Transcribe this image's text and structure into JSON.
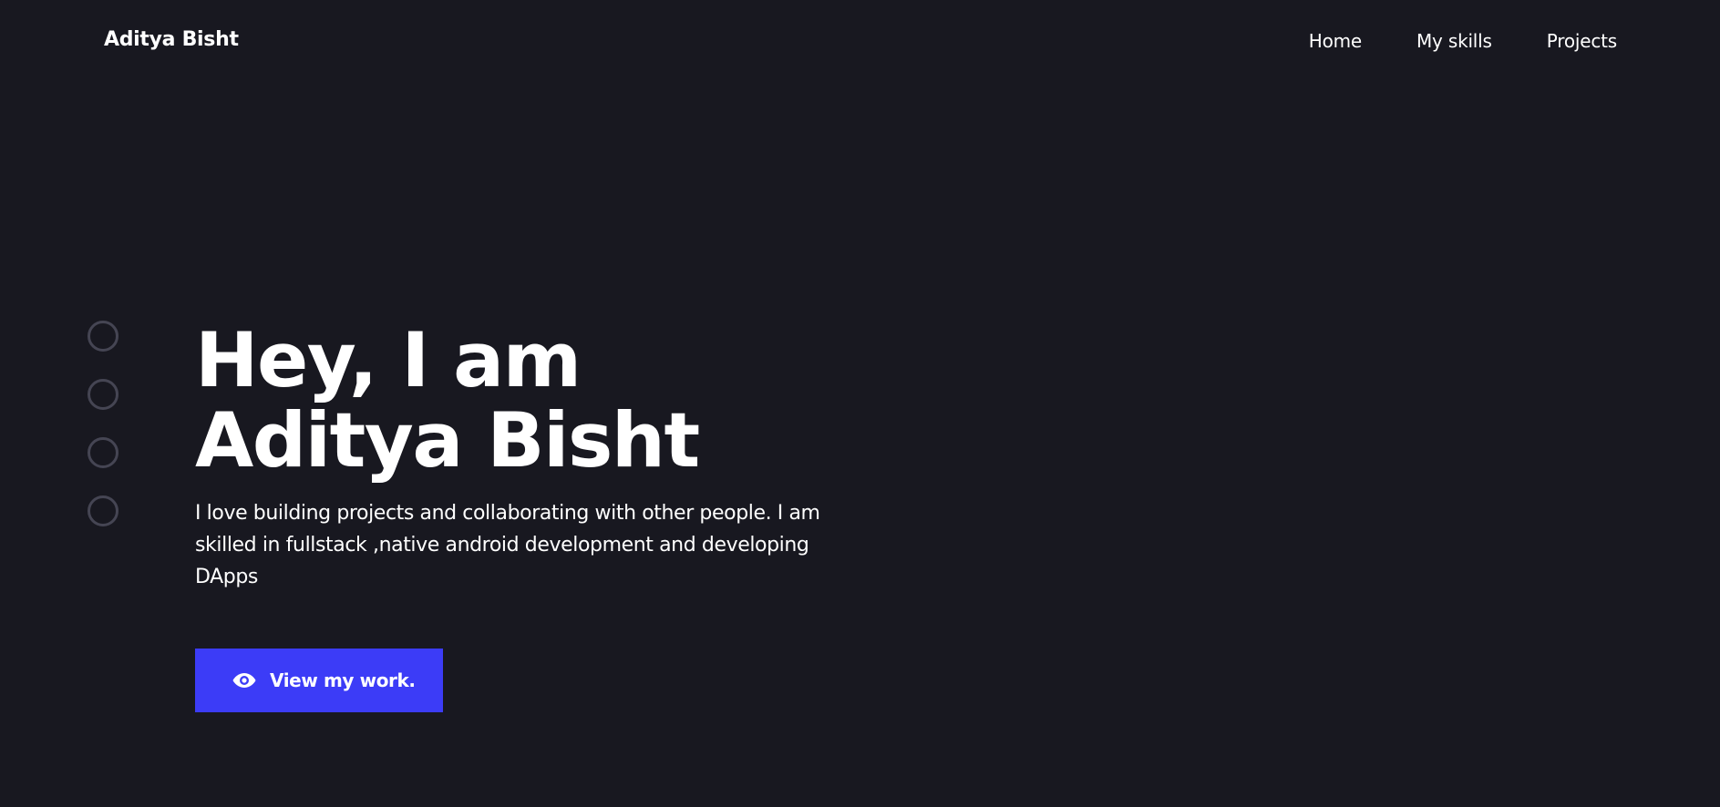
{
  "header": {
    "brand": "Aditya Bisht",
    "nav": [
      {
        "label": "Home"
      },
      {
        "label": "My skills"
      },
      {
        "label": "Projects"
      }
    ]
  },
  "side_nav": {
    "dots": 4
  },
  "hero": {
    "title_line_1": "Hey, I am",
    "title_line_2": "Aditya Bisht",
    "description": "I love building projects and collaborating with other people. I am skilled in fullstack ,native android development and developing DApps",
    "cta_label": "View my work.",
    "cta_icon": "eye-icon"
  },
  "colors": {
    "background": "#181820",
    "text": "#ffffff",
    "accent": "#3c3cf7",
    "dot_border": "#454553"
  }
}
